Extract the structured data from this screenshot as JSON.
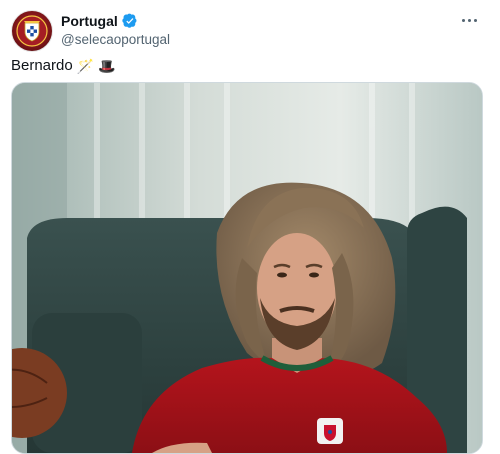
{
  "author": {
    "display_name": "Portugal",
    "handle": "@selecaoportugal",
    "verified": true,
    "avatar_icon": "portugal-crest-icon"
  },
  "tweet": {
    "text": "Bernardo",
    "emojis": [
      "🪄",
      "🎩"
    ]
  },
  "media": {
    "type": "video-still",
    "description_icon": "man-in-red-jersey-image"
  },
  "colors": {
    "brand_red": "#c8102e",
    "verified_blue": "#1d9bf0",
    "handle_gray": "#536471"
  }
}
